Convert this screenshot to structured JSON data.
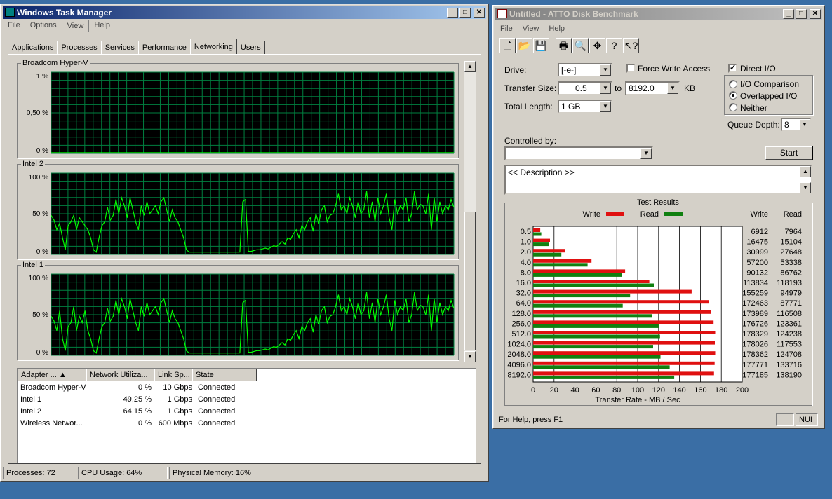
{
  "task_manager": {
    "title": "Windows Task Manager",
    "menu": [
      "File",
      "Options",
      "View",
      "Help"
    ],
    "tabs": [
      "Applications",
      "Processes",
      "Services",
      "Performance",
      "Networking",
      "Users"
    ],
    "active_tab": "Networking",
    "graphs": [
      {
        "label": "Broadcom Hyper-V",
        "ticks": [
          "1 %",
          "0,50 %",
          "0 %"
        ],
        "series": [
          0,
          0,
          0,
          0,
          0,
          0,
          0,
          0,
          0,
          0,
          0,
          0,
          0,
          0,
          0,
          0,
          0,
          0,
          0,
          0,
          0,
          0,
          0,
          0,
          0,
          0,
          0,
          0,
          0,
          0,
          0,
          0,
          0,
          0,
          0,
          0,
          0,
          0,
          0,
          0,
          0,
          0,
          0,
          0,
          0,
          0,
          0,
          0,
          0,
          0,
          0,
          0,
          0,
          0,
          0,
          0,
          0,
          0,
          0,
          0,
          0,
          0,
          0,
          0,
          0,
          0,
          0,
          0,
          0,
          0,
          0,
          0,
          0,
          0,
          0,
          0,
          0,
          0,
          0,
          0,
          0,
          0,
          0,
          0,
          0,
          0,
          0,
          0,
          0,
          0,
          0,
          0,
          0,
          0,
          0,
          0,
          0,
          0,
          0,
          0,
          0,
          0,
          0,
          0,
          0,
          0,
          0,
          0,
          0,
          0,
          0,
          0,
          0,
          0,
          0,
          0,
          0,
          0,
          0,
          0,
          0,
          0,
          0,
          0,
          0,
          0,
          0,
          0,
          0,
          0,
          0,
          0,
          0,
          0,
          0,
          0,
          0,
          0,
          0,
          0,
          0,
          0,
          0,
          0
        ]
      },
      {
        "label": "Intel 2",
        "ticks": [
          "100 %",
          "50 %",
          "0 %"
        ],
        "series": [
          48,
          42,
          30,
          38,
          20,
          5,
          35,
          40,
          48,
          30,
          45,
          40,
          35,
          30,
          20,
          5,
          2,
          20,
          35,
          40,
          58,
          42,
          48,
          68,
          50,
          70,
          60,
          45,
          70,
          55,
          40,
          30,
          60,
          48,
          65,
          50,
          55,
          60,
          50,
          65,
          70,
          55,
          40,
          55,
          45,
          40,
          30,
          20,
          5,
          2,
          2,
          2,
          2,
          2,
          2,
          2,
          2,
          2,
          2,
          2,
          2,
          2,
          2,
          2,
          2,
          2,
          2,
          2,
          65,
          68,
          3,
          3,
          4,
          5,
          5,
          6,
          7,
          6,
          8,
          10,
          9,
          12,
          15,
          12,
          20,
          18,
          25,
          30,
          20,
          35,
          30,
          40,
          45,
          28,
          50,
          38,
          55,
          60,
          40,
          48,
          50,
          60,
          75,
          55,
          60,
          50,
          70,
          60,
          45,
          65,
          50,
          55,
          78,
          45,
          65,
          40,
          70,
          50,
          60,
          75,
          45,
          30,
          68,
          50,
          60,
          55,
          70,
          40,
          50,
          78,
          55,
          62,
          60,
          50,
          75,
          30,
          70,
          40,
          65,
          50,
          60,
          55,
          68,
          58
        ]
      },
      {
        "label": "Intel 1",
        "ticks": [
          "100 %",
          "50 %",
          "0 %"
        ],
        "series": [
          48,
          42,
          30,
          55,
          20,
          5,
          35,
          40,
          60,
          30,
          48,
          40,
          55,
          30,
          20,
          5,
          2,
          20,
          35,
          40,
          58,
          42,
          48,
          68,
          50,
          70,
          60,
          45,
          70,
          55,
          40,
          30,
          60,
          48,
          65,
          50,
          55,
          60,
          50,
          65,
          70,
          55,
          40,
          55,
          45,
          40,
          30,
          20,
          5,
          2,
          2,
          2,
          2,
          2,
          2,
          2,
          2,
          2,
          2,
          2,
          2,
          2,
          2,
          2,
          2,
          2,
          2,
          2,
          65,
          68,
          3,
          3,
          4,
          5,
          5,
          6,
          7,
          6,
          8,
          10,
          9,
          12,
          15,
          12,
          20,
          18,
          25,
          30,
          20,
          35,
          30,
          40,
          45,
          28,
          50,
          38,
          55,
          60,
          40,
          48,
          50,
          60,
          75,
          55,
          60,
          50,
          70,
          60,
          45,
          65,
          50,
          55,
          78,
          45,
          65,
          40,
          70,
          50,
          60,
          75,
          45,
          30,
          68,
          50,
          60,
          55,
          70,
          40,
          50,
          78,
          55,
          62,
          60,
          50,
          75,
          30,
          70,
          40,
          65,
          50,
          60,
          55,
          68,
          58
        ]
      }
    ],
    "columns": [
      "Adapter ...",
      "Network Utiliza...",
      "Link Sp...",
      "State"
    ],
    "rows": [
      [
        "Broadcom Hyper-V",
        "0 %",
        "10 Gbps",
        "Connected"
      ],
      [
        "Intel 1",
        "49,25 %",
        "1 Gbps",
        "Connected"
      ],
      [
        "Intel 2",
        "64,15 %",
        "1 Gbps",
        "Connected"
      ],
      [
        "Wireless Networ...",
        "0 %",
        "600 Mbps",
        "Connected"
      ]
    ],
    "status": {
      "processes": "Processes: 72",
      "cpu": "CPU Usage: 64%",
      "memory": "Physical Memory: 16%"
    },
    "colors": {
      "graph_bg": "#000000",
      "grid": "#008040",
      "line": "#00ff00"
    }
  },
  "atto": {
    "title": "Untitled - ATTO Disk Benchmark",
    "menu": [
      "File",
      "View",
      "Help"
    ],
    "toolbar_icons": [
      "new-icon",
      "open-icon",
      "save-icon",
      "print-icon",
      "print-preview-icon",
      "move-icon",
      "help-icon",
      "context-help-icon"
    ],
    "drive_label": "Drive:",
    "drive_value": "[-e-]",
    "transfer_size_label": "Transfer Size:",
    "transfer_from": "0.5",
    "to_label": "to",
    "transfer_to": "8192.0",
    "kb_label": "KB",
    "total_length_label": "Total Length:",
    "total_length_value": "1 GB",
    "force_write_label": "Force Write Access",
    "force_write_checked": false,
    "direct_io_label": "Direct I/O",
    "direct_io_checked": true,
    "radio_options": [
      "I/O Comparison",
      "Overlapped I/O",
      "Neither"
    ],
    "radio_selected": "Overlapped I/O",
    "queue_depth_label": "Queue Depth:",
    "queue_depth_value": "8",
    "controlled_by_label": "Controlled by:",
    "controlled_by_value": "",
    "start_label": "Start",
    "description": "<< Description >>",
    "status_text": "For Help, press F1",
    "status_num": "NUI"
  },
  "chart_data": {
    "type": "bar",
    "title": "Test Results",
    "xlabel": "Transfer Rate - MB / Sec",
    "ylabel": "",
    "xlim": [
      0,
      200
    ],
    "x_ticks": [
      "0",
      "20",
      "40",
      "60",
      "80",
      "100",
      "120",
      "140",
      "160",
      "180",
      "200"
    ],
    "categories": [
      "0.5",
      "1.0",
      "2.0",
      "4.0",
      "8.0",
      "16.0",
      "32.0",
      "64.0",
      "128.0",
      "256.0",
      "512.0",
      "1024.0",
      "2048.0",
      "4096.0",
      "8192.0"
    ],
    "legend": [
      "Write",
      "Read"
    ],
    "table_headers": [
      "Write",
      "Read"
    ],
    "series": [
      {
        "name": "Write",
        "color": "#e01010",
        "values": [
          6912,
          16475,
          30999,
          57200,
          90132,
          113834,
          155259,
          172463,
          173989,
          176726,
          178329,
          178026,
          178362,
          177771,
          177185
        ]
      },
      {
        "name": "Read",
        "color": "#108010",
        "values": [
          7964,
          15104,
          27648,
          53338,
          86762,
          118193,
          94979,
          87771,
          116508,
          123361,
          124238,
          117553,
          124708,
          133716,
          138190
        ]
      }
    ],
    "grid": true
  }
}
